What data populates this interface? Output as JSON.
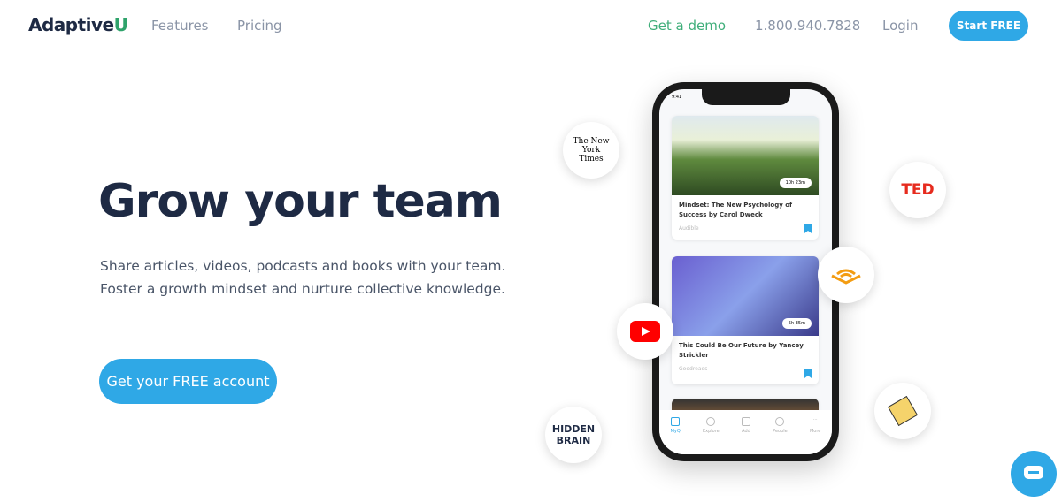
{
  "header": {
    "logo_main": "Adaptive",
    "logo_accent": "U",
    "nav": [
      "Features",
      "Pricing"
    ],
    "demo": "Get a demo",
    "phone": "1.800.940.7828",
    "login": "Login",
    "start": "Start FREE"
  },
  "hero": {
    "title": "Grow your team",
    "line1": "Share articles, videos, podcasts and books with your team.",
    "line2": "Foster a growth mindset and nurture collective knowledge.",
    "cta": "Get your FREE account"
  },
  "phone": {
    "time": "9:41",
    "cards": [
      {
        "title": "Mindset: The New Psychology of Success by Carol Dweck",
        "source": "Audible",
        "duration": "10h 23m"
      },
      {
        "title": "This Could Be Our Future by Yancey Strickler",
        "source": "Goodreads",
        "duration": "5h 35m"
      }
    ],
    "tabs": [
      "MyQ",
      "Explore",
      "Add",
      "People",
      "More"
    ]
  },
  "badges": {
    "nyt": "The New York Times",
    "ted": "TED",
    "hidden_brain": "HIDDEN BRAIN"
  },
  "colors": {
    "accent": "#2fa8e6",
    "green": "#2fa36b",
    "navy": "#1e2a44"
  }
}
